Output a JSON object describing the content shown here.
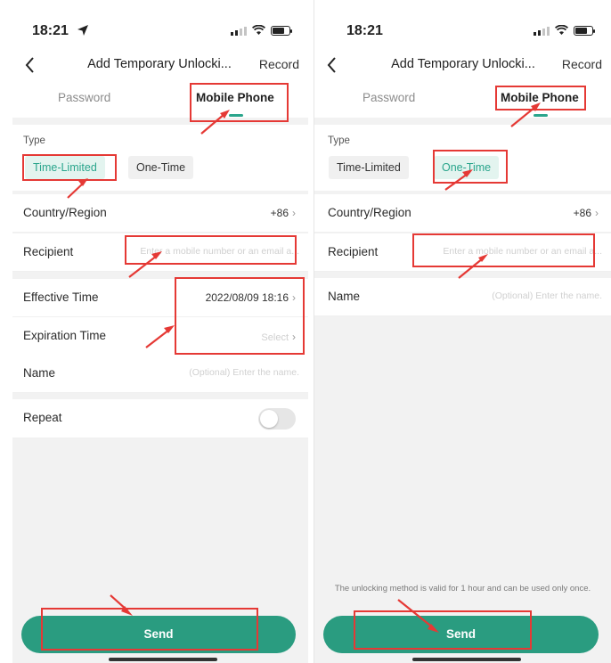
{
  "colors": {
    "accent": "#2aa58c",
    "send_button": "#2a9c80",
    "annotation": "#e53935"
  },
  "left": {
    "status_time": "18:21",
    "nav": {
      "back_icon": "chevron-left-icon",
      "title": "Add Temporary Unlocki...",
      "record": "Record"
    },
    "tabs": {
      "password": "Password",
      "mobile_phone": "Mobile Phone",
      "active": "Mobile Phone"
    },
    "type_label": "Type",
    "types": {
      "time_limited": "Time-Limited",
      "one_time": "One-Time",
      "selected": "Time-Limited"
    },
    "country_region": {
      "label": "Country/Region",
      "value": "+86"
    },
    "recipient": {
      "label": "Recipient",
      "placeholder": "Enter a mobile number or an email a..."
    },
    "effective_time": {
      "label": "Effective Time",
      "value": "2022/08/09 18:16"
    },
    "expiration_time": {
      "label": "Expiration Time",
      "placeholder": "Select"
    },
    "name": {
      "label": "Name",
      "placeholder": "(Optional) Enter the name."
    },
    "repeat": {
      "label": "Repeat",
      "enabled": false
    },
    "send": "Send"
  },
  "right": {
    "status_time": "18:21",
    "nav": {
      "back_icon": "chevron-left-icon",
      "title": "Add Temporary Unlocki...",
      "record": "Record"
    },
    "tabs": {
      "password": "Password",
      "mobile_phone": "Mobile Phone",
      "active": "Mobile Phone"
    },
    "type_label": "Type",
    "types": {
      "time_limited": "Time-Limited",
      "one_time": "One-Time",
      "selected": "One-Time"
    },
    "country_region": {
      "label": "Country/Region",
      "value": "+86"
    },
    "recipient": {
      "label": "Recipient",
      "placeholder": "Enter a mobile number or an email a..."
    },
    "name": {
      "label": "Name",
      "placeholder": "(Optional) Enter the name."
    },
    "note": "The unlocking method is valid for 1 hour and can be used only once.",
    "send": "Send"
  }
}
